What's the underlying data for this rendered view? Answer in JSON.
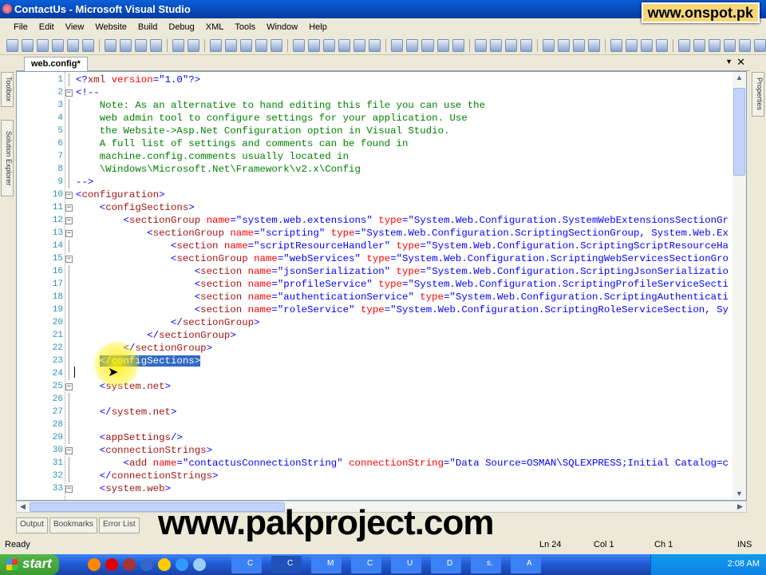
{
  "window": {
    "title": "ContactUs - Microsoft Visual Studio"
  },
  "watermarks": {
    "top": "www.onspot.pk",
    "overlay": "www.pakproject.com"
  },
  "menu": [
    "File",
    "Edit",
    "View",
    "Website",
    "Build",
    "Debug",
    "XML",
    "Tools",
    "Window",
    "Help"
  ],
  "side_tabs": {
    "left": [
      "Toolbox",
      "Solution Explorer"
    ],
    "right": [
      "Properties"
    ]
  },
  "document_tab": "web.config*",
  "editor": {
    "lines": [
      {
        "n": "1",
        "t": [
          [
            "d",
            "<?"
          ],
          [
            "e",
            "xml"
          ],
          [
            "a",
            " version"
          ],
          [
            "d",
            "=\""
          ],
          [
            "v",
            "1.0"
          ],
          [
            "d",
            "\"?>"
          ]
        ]
      },
      {
        "n": "2",
        "fold": true,
        "t": [
          [
            "d",
            "<!--"
          ]
        ]
      },
      {
        "n": "3",
        "t": [
          [
            "c",
            "    Note: As an alternative to hand editing this file you can use the"
          ]
        ]
      },
      {
        "n": "4",
        "t": [
          [
            "c",
            "    web admin tool to configure settings for your application. Use"
          ]
        ]
      },
      {
        "n": "5",
        "t": [
          [
            "c",
            "    the Website->Asp.Net Configuration option in Visual Studio."
          ]
        ]
      },
      {
        "n": "6",
        "t": [
          [
            "c",
            "    A full list of settings and comments can be found in"
          ]
        ]
      },
      {
        "n": "7",
        "t": [
          [
            "c",
            "    machine.config.comments usually located in"
          ]
        ]
      },
      {
        "n": "8",
        "t": [
          [
            "c",
            "    \\Windows\\Microsoft.Net\\Framework\\v2.x\\Config"
          ]
        ]
      },
      {
        "n": "9",
        "t": [
          [
            "d",
            "-->"
          ]
        ]
      },
      {
        "n": "10",
        "fold": true,
        "t": [
          [
            "d",
            "<"
          ],
          [
            "e",
            "configuration"
          ],
          [
            "d",
            ">"
          ]
        ]
      },
      {
        "n": "11",
        "fold": true,
        "t": [
          [
            "p",
            "    "
          ],
          [
            "d",
            "<"
          ],
          [
            "e",
            "configSections"
          ],
          [
            "d",
            ">"
          ]
        ]
      },
      {
        "n": "12",
        "fold": true,
        "t": [
          [
            "p",
            "        "
          ],
          [
            "d",
            "<"
          ],
          [
            "e",
            "sectionGroup"
          ],
          [
            "a",
            " name"
          ],
          [
            "d",
            "=\""
          ],
          [
            "v",
            "system.web.extensions"
          ],
          [
            "d",
            "\""
          ],
          [
            "a",
            " type"
          ],
          [
            "d",
            "=\""
          ],
          [
            "v",
            "System.Web.Configuration.SystemWebExtensionsSectionGr"
          ]
        ]
      },
      {
        "n": "13",
        "fold": true,
        "t": [
          [
            "p",
            "            "
          ],
          [
            "d",
            "<"
          ],
          [
            "e",
            "sectionGroup"
          ],
          [
            "a",
            " name"
          ],
          [
            "d",
            "=\""
          ],
          [
            "v",
            "scripting"
          ],
          [
            "d",
            "\""
          ],
          [
            "a",
            " type"
          ],
          [
            "d",
            "=\""
          ],
          [
            "v",
            "System.Web.Configuration.ScriptingSectionGroup, System.Web.Ex"
          ]
        ]
      },
      {
        "n": "14",
        "t": [
          [
            "p",
            "                "
          ],
          [
            "d",
            "<"
          ],
          [
            "e",
            "section"
          ],
          [
            "a",
            " name"
          ],
          [
            "d",
            "=\""
          ],
          [
            "v",
            "scriptResourceHandler"
          ],
          [
            "d",
            "\""
          ],
          [
            "a",
            " type"
          ],
          [
            "d",
            "=\""
          ],
          [
            "v",
            "System.Web.Configuration.ScriptingScriptResourceHa"
          ]
        ]
      },
      {
        "n": "15",
        "fold": true,
        "t": [
          [
            "p",
            "                "
          ],
          [
            "d",
            "<"
          ],
          [
            "e",
            "sectionGroup"
          ],
          [
            "a",
            " name"
          ],
          [
            "d",
            "=\""
          ],
          [
            "v",
            "webServices"
          ],
          [
            "d",
            "\""
          ],
          [
            "a",
            " type"
          ],
          [
            "d",
            "=\""
          ],
          [
            "v",
            "System.Web.Configuration.ScriptingWebServicesSectionGro"
          ]
        ]
      },
      {
        "n": "16",
        "t": [
          [
            "p",
            "                    "
          ],
          [
            "d",
            "<"
          ],
          [
            "e",
            "section"
          ],
          [
            "a",
            " name"
          ],
          [
            "d",
            "=\""
          ],
          [
            "v",
            "jsonSerialization"
          ],
          [
            "d",
            "\""
          ],
          [
            "a",
            " type"
          ],
          [
            "d",
            "=\""
          ],
          [
            "v",
            "System.Web.Configuration.ScriptingJsonSerializatio"
          ]
        ]
      },
      {
        "n": "17",
        "t": [
          [
            "p",
            "                    "
          ],
          [
            "d",
            "<"
          ],
          [
            "e",
            "section"
          ],
          [
            "a",
            " name"
          ],
          [
            "d",
            "=\""
          ],
          [
            "v",
            "profileService"
          ],
          [
            "d",
            "\""
          ],
          [
            "a",
            " type"
          ],
          [
            "d",
            "=\""
          ],
          [
            "v",
            "System.Web.Configuration.ScriptingProfileServiceSecti"
          ]
        ]
      },
      {
        "n": "18",
        "t": [
          [
            "p",
            "                    "
          ],
          [
            "d",
            "<"
          ],
          [
            "e",
            "section"
          ],
          [
            "a",
            " name"
          ],
          [
            "d",
            "=\""
          ],
          [
            "v",
            "authenticationService"
          ],
          [
            "d",
            "\""
          ],
          [
            "a",
            " type"
          ],
          [
            "d",
            "=\""
          ],
          [
            "v",
            "System.Web.Configuration.ScriptingAuthenticati"
          ]
        ]
      },
      {
        "n": "19",
        "t": [
          [
            "p",
            "                    "
          ],
          [
            "d",
            "<"
          ],
          [
            "e",
            "section"
          ],
          [
            "a",
            " name"
          ],
          [
            "d",
            "=\""
          ],
          [
            "v",
            "roleService"
          ],
          [
            "d",
            "\""
          ],
          [
            "a",
            " type"
          ],
          [
            "d",
            "=\""
          ],
          [
            "v",
            "System.Web.Configuration.ScriptingRoleServiceSection, Sy"
          ]
        ]
      },
      {
        "n": "20",
        "t": [
          [
            "p",
            "                "
          ],
          [
            "d",
            "</"
          ],
          [
            "e",
            "sectionGroup"
          ],
          [
            "d",
            ">"
          ]
        ]
      },
      {
        "n": "21",
        "t": [
          [
            "p",
            "            "
          ],
          [
            "d",
            "</"
          ],
          [
            "e",
            "sectionGroup"
          ],
          [
            "d",
            ">"
          ]
        ]
      },
      {
        "n": "22",
        "t": [
          [
            "p",
            "        "
          ],
          [
            "d",
            "</"
          ],
          [
            "e",
            "sectionGroup"
          ],
          [
            "d",
            ">"
          ]
        ]
      },
      {
        "n": "23",
        "sel": true,
        "t": [
          [
            "p",
            "    "
          ],
          [
            "d",
            "</"
          ],
          [
            "e",
            "configSections"
          ],
          [
            "d",
            ">"
          ]
        ]
      },
      {
        "n": "24",
        "t": []
      },
      {
        "n": "25",
        "fold": true,
        "t": [
          [
            "p",
            "    "
          ],
          [
            "d",
            "<"
          ],
          [
            "e",
            "system.net"
          ],
          [
            "d",
            ">"
          ]
        ]
      },
      {
        "n": "26",
        "t": []
      },
      {
        "n": "27",
        "t": [
          [
            "p",
            "    "
          ],
          [
            "d",
            "</"
          ],
          [
            "e",
            "system.net"
          ],
          [
            "d",
            ">"
          ]
        ]
      },
      {
        "n": "28",
        "t": []
      },
      {
        "n": "29",
        "t": [
          [
            "p",
            "    "
          ],
          [
            "d",
            "<"
          ],
          [
            "e",
            "appSettings"
          ],
          [
            "d",
            "/>"
          ]
        ]
      },
      {
        "n": "30",
        "fold": true,
        "t": [
          [
            "p",
            "    "
          ],
          [
            "d",
            "<"
          ],
          [
            "e",
            "connectionStrings"
          ],
          [
            "d",
            ">"
          ]
        ]
      },
      {
        "n": "31",
        "t": [
          [
            "p",
            "        "
          ],
          [
            "d",
            "<"
          ],
          [
            "e",
            "add"
          ],
          [
            "a",
            " name"
          ],
          [
            "d",
            "=\""
          ],
          [
            "v",
            "contactusConnectionString"
          ],
          [
            "d",
            "\""
          ],
          [
            "a",
            " connectionString"
          ],
          [
            "d",
            "=\""
          ],
          [
            "v",
            "Data Source=OSMAN\\SQLEXPRESS;Initial Catalog=c"
          ]
        ]
      },
      {
        "n": "32",
        "t": [
          [
            "p",
            "    "
          ],
          [
            "d",
            "</"
          ],
          [
            "e",
            "connectionStrings"
          ],
          [
            "d",
            ">"
          ]
        ]
      },
      {
        "n": "33",
        "fold": true,
        "t": [
          [
            "p",
            "    "
          ],
          [
            "d",
            "<"
          ],
          [
            "e",
            "system.web"
          ],
          [
            "d",
            ">"
          ]
        ]
      }
    ]
  },
  "bottom_tabs": [
    "Output",
    "Bookmarks",
    "Error List"
  ],
  "status": {
    "text": "Ready",
    "line": "Ln 24",
    "col": "Col 1",
    "ch": "Ch 1",
    "mode": "INS"
  },
  "taskbar": {
    "start": "start",
    "tasks": [
      "C",
      "C",
      "M",
      "C",
      "U",
      "D",
      "s.",
      "A"
    ],
    "clock": "2:08 AM"
  }
}
